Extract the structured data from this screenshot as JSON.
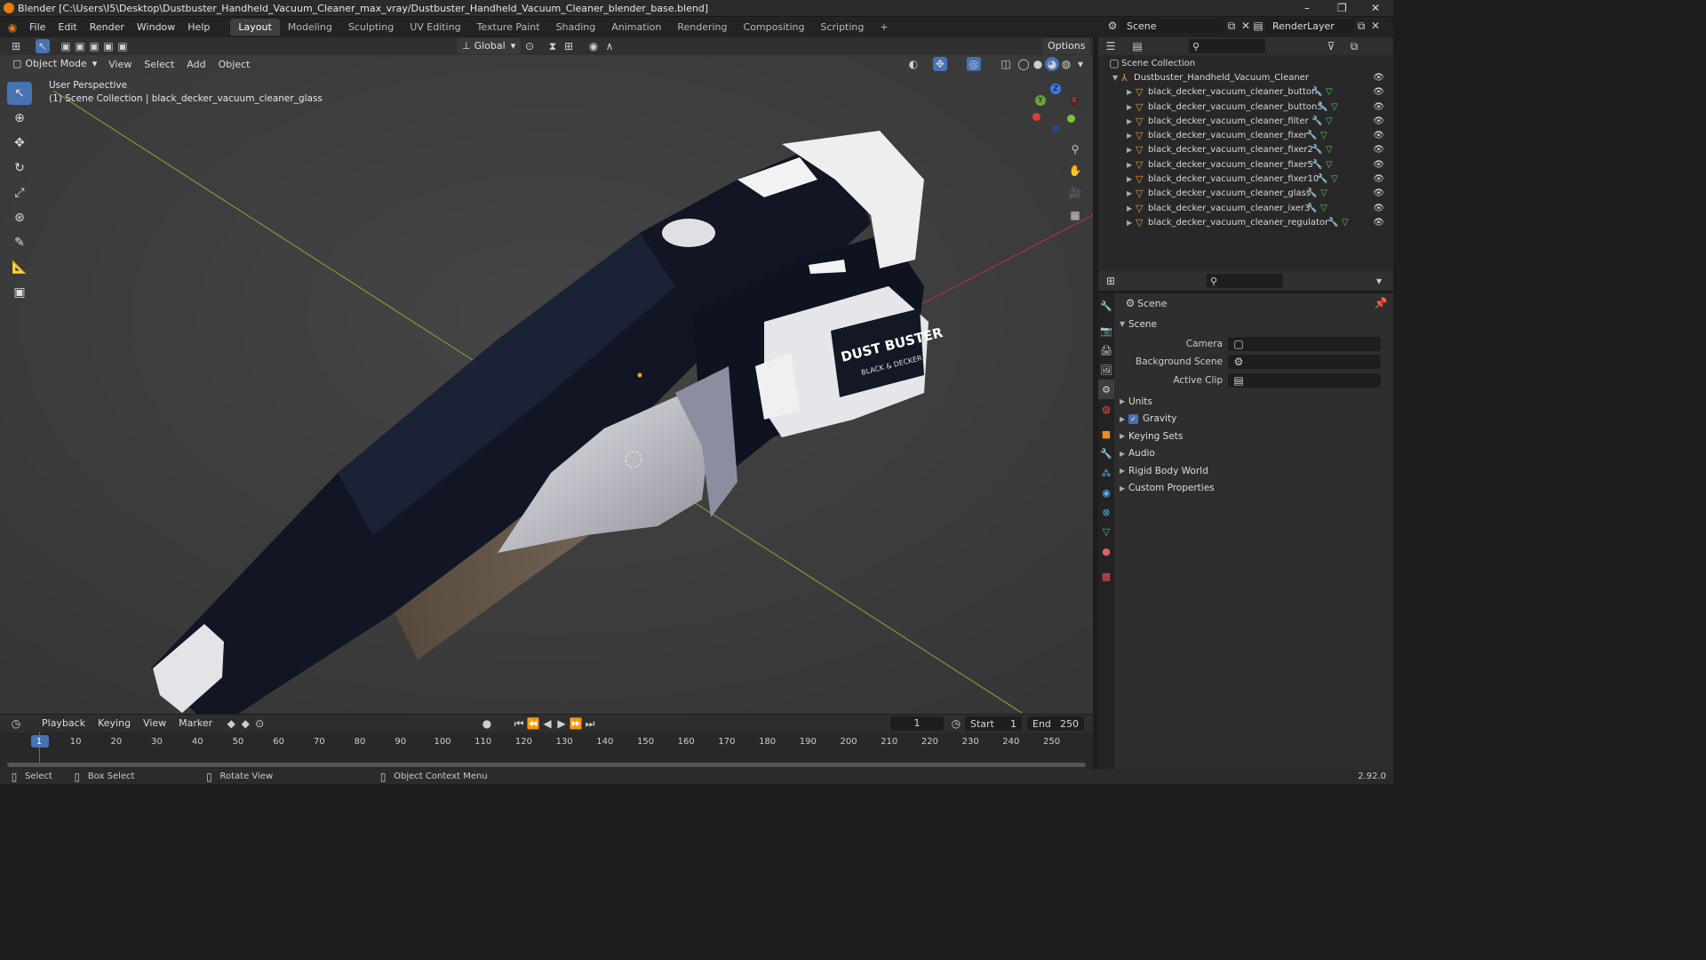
{
  "window": {
    "title": "Blender [C:\\Users\\I5\\Desktop\\Dustbuster_Handheld_Vacuum_Cleaner_max_vray/Dustbuster_Handheld_Vacuum_Cleaner_blender_base.blend]",
    "controls": [
      "–",
      "❐",
      "✕"
    ]
  },
  "menu": [
    "File",
    "Edit",
    "Render",
    "Window",
    "Help"
  ],
  "workspaces": [
    "Layout",
    "Modeling",
    "Sculpting",
    "UV Editing",
    "Texture Paint",
    "Shading",
    "Animation",
    "Rendering",
    "Compositing",
    "Scripting"
  ],
  "add_workspace": "+",
  "scene_selector": {
    "label": "Scene",
    "layer": "RenderLayer"
  },
  "viewport_header": {
    "mode": "Object Mode",
    "menus": [
      "View",
      "Select",
      "Add",
      "Object"
    ],
    "transform": "Global",
    "options": "Options"
  },
  "viewport": {
    "perspective": "User Perspective",
    "collection_line": "(1) Scene Collection | black_decker_vacuum_cleaner_glass",
    "gizmo": {
      "x": "X",
      "y": "Y",
      "z": "Z"
    },
    "product_label_1": "DUST BUSTER",
    "product_label_2": "BLACK & DECKER"
  },
  "outliner": {
    "root": "Scene Collection",
    "collection": "Dustbuster_Handheld_Vacuum_Cleaner",
    "objects": [
      "black_decker_vacuum_cleaner_button",
      "black_decker_vacuum_cleaner_button3",
      "black_decker_vacuum_cleaner_filter",
      "black_decker_vacuum_cleaner_fixer",
      "black_decker_vacuum_cleaner_fixer2",
      "black_decker_vacuum_cleaner_fixer5",
      "black_decker_vacuum_cleaner_fixer10",
      "black_decker_vacuum_cleaner_glass",
      "black_decker_vacuum_cleaner_ixer3",
      "black_decker_vacuum_cleaner_regulator"
    ]
  },
  "properties": {
    "context": "Scene",
    "section": "Scene",
    "fields": [
      {
        "label": "Camera",
        "value": ""
      },
      {
        "label": "Background Scene",
        "value": ""
      },
      {
        "label": "Active Clip",
        "value": ""
      }
    ],
    "panels": [
      "Units",
      "Gravity",
      "Keying Sets",
      "Audio",
      "Rigid Body World",
      "Custom Properties"
    ],
    "gravity_checked": true
  },
  "timeline": {
    "menus": [
      "Playback",
      "Keying",
      "View",
      "Marker"
    ],
    "current_frame": "1",
    "start_label": "Start",
    "start": "1",
    "end_label": "End",
    "end": "250",
    "ticks": [
      "1",
      "10",
      "20",
      "30",
      "40",
      "50",
      "60",
      "70",
      "80",
      "90",
      "100",
      "110",
      "120",
      "130",
      "140",
      "150",
      "160",
      "170",
      "180",
      "190",
      "200",
      "210",
      "220",
      "230",
      "240",
      "250"
    ]
  },
  "statusbar": {
    "items": [
      "Select",
      "Box Select",
      "Rotate View",
      "Object Context Menu"
    ],
    "version": "2.92.0"
  },
  "colors": {
    "accent": "#4772b3",
    "orange": "#e87d0d",
    "mesh": "#e49a4a",
    "modifier": "#4fb8e9"
  }
}
